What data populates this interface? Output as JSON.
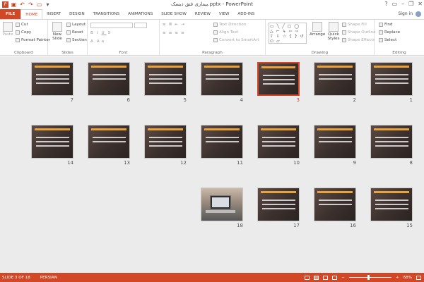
{
  "titlebar": {
    "title": "بیماری فتق دیسک.pptx - PowerPoint",
    "qat_icons": [
      "save-icon",
      "undo-icon",
      "redo-icon",
      "present-icon",
      "customize-icon"
    ],
    "controls": [
      "?",
      "▭",
      "–",
      "❐",
      "✕"
    ]
  },
  "tabs": [
    "FILE",
    "HOME",
    "INSERT",
    "DESIGN",
    "TRANSITIONS",
    "ANIMATIONS",
    "SLIDE SHOW",
    "REVIEW",
    "VIEW",
    "ADD-INS"
  ],
  "active_tab": "HOME",
  "signin": "Sign in",
  "ribbon": {
    "clipboard": {
      "label": "Clipboard",
      "paste": "Paste",
      "cut": "Cut",
      "copy": "Copy",
      "format_painter": "Format Painter"
    },
    "slides": {
      "label": "Slides",
      "new_slide": "New Slide",
      "layout": "Layout",
      "reset": "Reset",
      "section": "Section"
    },
    "font": {
      "label": "Font"
    },
    "paragraph": {
      "label": "Paragraph",
      "text_direction": "Text Direction",
      "align_text": "Align Text",
      "convert_smartart": "Convert to SmartArt"
    },
    "drawing": {
      "label": "Drawing",
      "arrange": "Arrange",
      "quick_styles": "Quick Styles",
      "shape_fill": "Shape Fill",
      "shape_outline": "Shape Outline",
      "shape_effects": "Shape Effects",
      "shapes_glyphs": "▭ ╲ ╱ ▢ ◯ △ ⌐ ↳ ⇦ ⇨ ⇧ ⇩ ☆ { } ↺ ⬭ ▱"
    },
    "editing": {
      "label": "Editing",
      "find": "Find",
      "replace": "Replace",
      "select": "Select"
    }
  },
  "slides": [
    {
      "number": "1"
    },
    {
      "number": "2"
    },
    {
      "number": "3",
      "selected": true
    },
    {
      "number": "4"
    },
    {
      "number": "5"
    },
    {
      "number": "6"
    },
    {
      "number": "7"
    },
    {
      "number": "8"
    },
    {
      "number": "9"
    },
    {
      "number": "10"
    },
    {
      "number": "11"
    },
    {
      "number": "12"
    },
    {
      "number": "13"
    },
    {
      "number": "14"
    },
    {
      "number": "15"
    },
    {
      "number": "16"
    },
    {
      "number": "17"
    },
    {
      "number": "18",
      "photo": true
    }
  ],
  "status": {
    "slide_info": "SLIDE 3 OF 18",
    "language": "PERSIAN",
    "zoom": "68%"
  },
  "colors": {
    "accent": "#D24726",
    "slide_title": "#E8A33D",
    "slide_bg": "#3B302D"
  }
}
